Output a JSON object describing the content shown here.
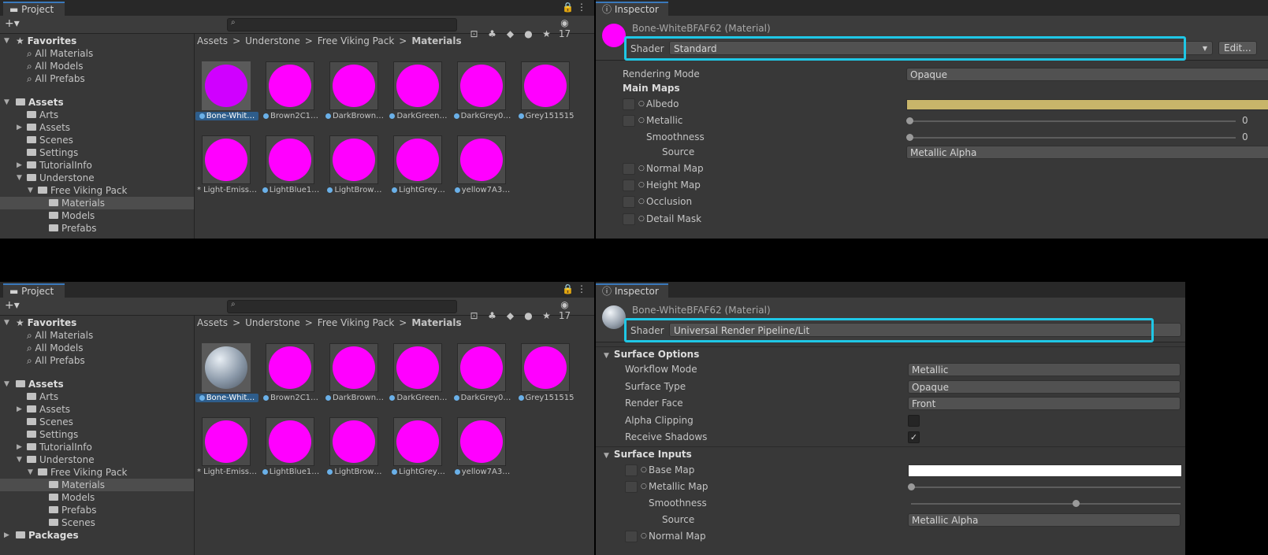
{
  "project_tab": "Project",
  "inspector_tab": "Inspector",
  "visibility_count": "17",
  "favorites": {
    "header": "Favorites",
    "items": [
      "All Materials",
      "All Models",
      "All Prefabs"
    ]
  },
  "assets_header": "Assets",
  "tree_top": [
    "Arts",
    "Assets",
    "Scenes",
    "Settings",
    "TutorialInfo",
    "Understone",
    "Free Viking Pack",
    "Materials",
    "Models",
    "Prefabs"
  ],
  "tree_bottom": [
    "Arts",
    "Assets",
    "Scenes",
    "Settings",
    "TutorialInfo",
    "Understone",
    "Free Viking Pack",
    "Materials",
    "Models",
    "Prefabs",
    "Scenes"
  ],
  "packages": "Packages",
  "breadcrumb": [
    "Assets",
    ">",
    "Understone",
    ">",
    "Free Viking Pack",
    ">",
    "Materials"
  ],
  "materials": [
    "Bone-Whit…",
    "Brown2C1…",
    "DarkBrown…",
    "DarkGreen…",
    "DarkGrey0…",
    "Grey151515",
    "Light-Emiss…",
    "LightBlue1…",
    "LightBrow…",
    "LightGrey…",
    "yellow7A3…"
  ],
  "material_title": "Bone-WhiteBFAF62 (Material)",
  "shader_label": "Shader",
  "top_inspector": {
    "shader": "Standard",
    "edit_button": "Edit...",
    "rendering_mode_label": "Rendering Mode",
    "rendering_mode": "Opaque",
    "main_maps": "Main Maps",
    "albedo": "Albedo",
    "albedo_color": "#c8b56a",
    "metallic": "Metallic",
    "metallic_value": "0",
    "smoothness": "Smoothness",
    "smoothness_value": "0",
    "source": "Source",
    "source_value": "Metallic Alpha",
    "normal_map": "Normal Map",
    "height_map": "Height Map",
    "occlusion": "Occlusion",
    "detail_mask": "Detail Mask"
  },
  "bottom_inspector": {
    "shader": "Universal Render Pipeline/Lit",
    "surface_options": "Surface Options",
    "workflow_mode_label": "Workflow Mode",
    "workflow_mode": "Metallic",
    "surface_type_label": "Surface Type",
    "surface_type": "Opaque",
    "render_face_label": "Render Face",
    "render_face": "Front",
    "alpha_clipping": "Alpha Clipping",
    "alpha_clipping_checked": false,
    "receive_shadows": "Receive Shadows",
    "receive_shadows_checked": true,
    "check_mark": "✓",
    "surface_inputs": "Surface Inputs",
    "base_map": "Base Map",
    "base_color": "#ffffff",
    "metallic_map": "Metallic Map",
    "smoothness": "Smoothness",
    "smoothness_value": 0.5,
    "source": "Source",
    "source_value": "Metallic Alpha",
    "normal_map": "Normal Map"
  },
  "colors": {
    "highlight": "#1fc7e6",
    "missing_shader": "#ff00ff",
    "selection": "#2e5d8b"
  }
}
